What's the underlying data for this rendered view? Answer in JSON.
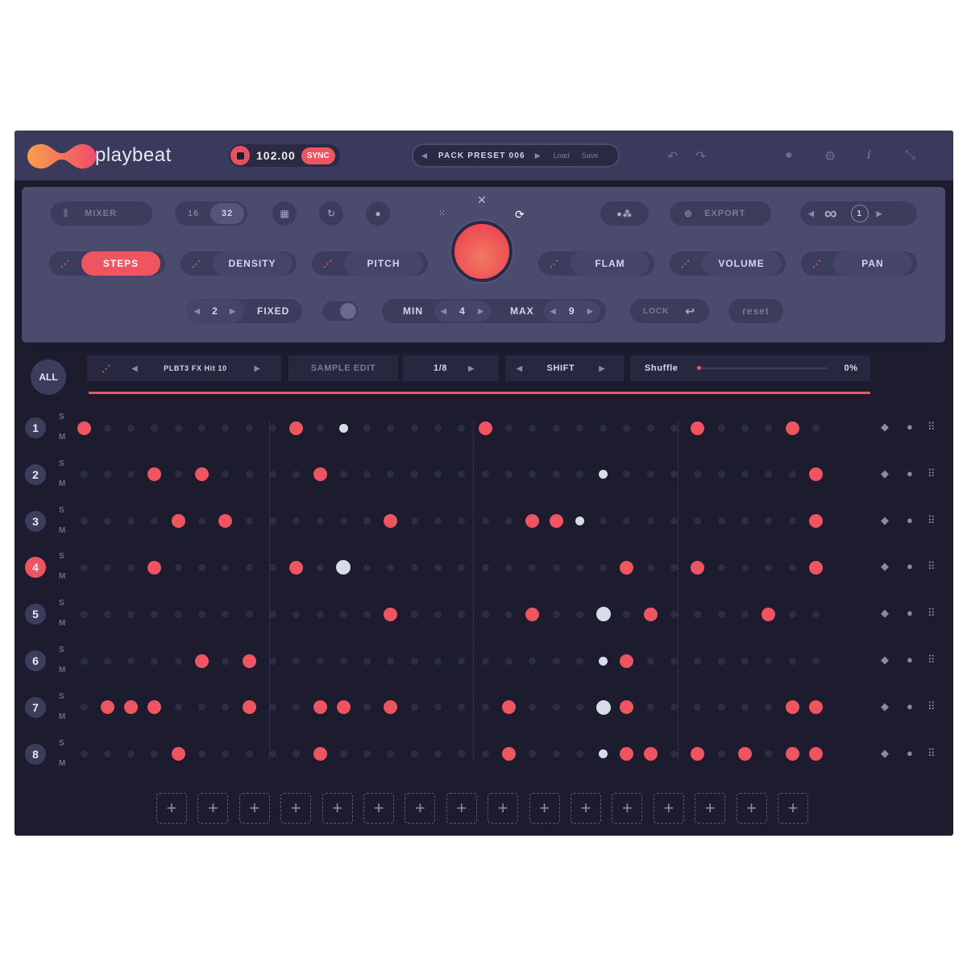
{
  "app": {
    "name": "playbeat"
  },
  "transport": {
    "tempo": "102.00",
    "sync_label": "SYNC"
  },
  "preset": {
    "name": "PACK PRESET 006",
    "load_label": "Load",
    "save_label": "Save"
  },
  "panel": {
    "mixer_label": "MIXER",
    "steps_options": [
      "16",
      "32"
    ],
    "steps_selected": "32",
    "export_label": "EXPORT",
    "loop_count": "1",
    "modes": [
      "STEPS",
      "DENSITY",
      "PITCH",
      "FLAM",
      "VOLUME",
      "PAN"
    ],
    "active_mode": "STEPS",
    "fixed_value": "2",
    "fixed_label": "FIXED",
    "min_label": "MIN",
    "min_value": "4",
    "max_label": "MAX",
    "max_value": "9",
    "lock_label": "LOCK",
    "reset_label": "reset"
  },
  "track_header": {
    "all_label": "ALL",
    "sample_name": "PLBT3 FX Hit 10",
    "sample_edit_label": "SAMPLE EDIT",
    "rate": "1/8",
    "shift_label": "SHIFT",
    "shuffle_label": "Shuffle",
    "shuffle_value": "0%",
    "shuffle_level": 0
  },
  "tracks": [
    {
      "number": "1",
      "solo": "S",
      "mute": "M",
      "active": false
    },
    {
      "number": "2",
      "solo": "S",
      "mute": "M",
      "active": false
    },
    {
      "number": "3",
      "solo": "S",
      "mute": "M",
      "active": false
    },
    {
      "number": "4",
      "solo": "S",
      "mute": "M",
      "active": true
    },
    {
      "number": "5",
      "solo": "S",
      "mute": "M",
      "active": false
    },
    {
      "number": "6",
      "solo": "S",
      "mute": "M",
      "active": false
    },
    {
      "number": "7",
      "solo": "S",
      "mute": "M",
      "active": false
    },
    {
      "number": "8",
      "solo": "S",
      "mute": "M",
      "active": false
    }
  ],
  "pattern": {
    "steps": 32,
    "playhead_step": 22,
    "rows": [
      [
        1,
        0,
        0,
        0,
        0,
        0,
        0,
        0,
        0,
        1,
        0,
        2,
        0,
        0,
        0,
        0,
        0,
        1,
        0,
        0,
        0,
        0,
        0,
        0,
        0,
        0,
        1,
        0,
        0,
        0,
        1,
        0
      ],
      [
        0,
        0,
        0,
        1,
        0,
        1,
        0,
        0,
        0,
        0,
        1,
        0,
        0,
        0,
        0,
        0,
        0,
        0,
        0,
        0,
        0,
        0,
        2,
        0,
        0,
        0,
        0,
        0,
        0,
        0,
        0,
        1
      ],
      [
        0,
        0,
        0,
        0,
        1,
        0,
        1,
        0,
        0,
        0,
        0,
        0,
        0,
        1,
        0,
        0,
        0,
        0,
        0,
        1,
        1,
        2,
        0,
        0,
        0,
        0,
        0,
        0,
        0,
        0,
        0,
        1
      ],
      [
        0,
        0,
        0,
        1,
        0,
        0,
        0,
        0,
        0,
        1,
        0,
        3,
        0,
        0,
        0,
        0,
        0,
        0,
        0,
        0,
        0,
        0,
        0,
        1,
        0,
        0,
        1,
        0,
        0,
        0,
        0,
        1
      ],
      [
        0,
        0,
        0,
        0,
        0,
        0,
        0,
        0,
        0,
        0,
        0,
        0,
        0,
        1,
        0,
        0,
        0,
        0,
        0,
        1,
        0,
        0,
        3,
        0,
        1,
        0,
        0,
        0,
        0,
        1,
        0,
        0
      ],
      [
        0,
        0,
        0,
        0,
        0,
        1,
        0,
        1,
        0,
        0,
        0,
        0,
        0,
        0,
        0,
        0,
        0,
        0,
        0,
        0,
        0,
        0,
        2,
        1,
        0,
        0,
        0,
        0,
        0,
        0,
        0,
        0
      ],
      [
        0,
        1,
        1,
        1,
        0,
        0,
        0,
        1,
        0,
        0,
        1,
        1,
        0,
        1,
        0,
        0,
        0,
        0,
        1,
        0,
        0,
        0,
        3,
        1,
        0,
        0,
        0,
        0,
        0,
        0,
        1,
        1
      ],
      [
        0,
        0,
        0,
        0,
        1,
        0,
        0,
        0,
        0,
        0,
        1,
        0,
        0,
        0,
        0,
        0,
        0,
        0,
        1,
        0,
        0,
        0,
        2,
        1,
        1,
        0,
        1,
        0,
        1,
        0,
        1,
        1
      ]
    ]
  },
  "add_tracks_count": 16,
  "colors": {
    "accent": "#ef5560",
    "playhead": "#d8dbe8",
    "inactive_dot": "#2c2c46",
    "panel": "#4b4b6e",
    "background": "#1c1c2e"
  },
  "icons": [
    "record-icon",
    "undo-icon",
    "redo-icon",
    "palette-icon",
    "gear-icon",
    "info-icon",
    "resize-icon",
    "grid-icon",
    "rotate-icon",
    "drop-icon",
    "shuffle-icon",
    "link-icon",
    "infinity-icon",
    "lock-icon",
    "pencil-icon",
    "eraser-icon",
    "drag-handle-icon",
    "plus-icon"
  ]
}
